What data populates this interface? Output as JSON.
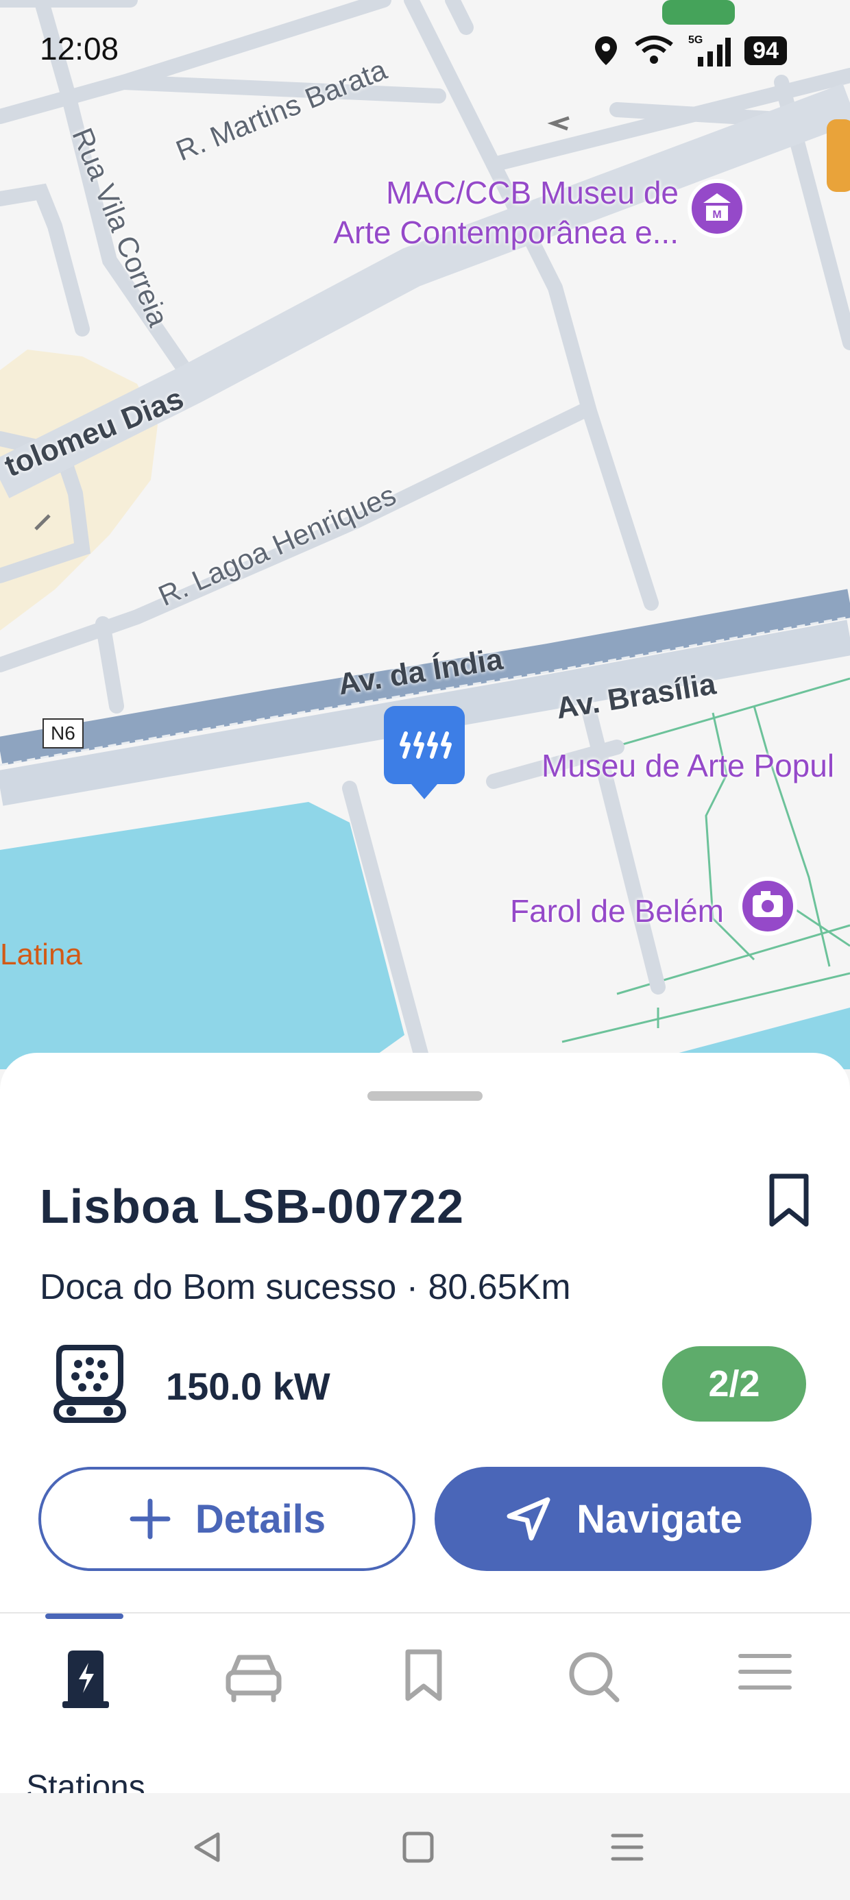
{
  "status_bar": {
    "time": "12:08",
    "battery": "94",
    "network": "5G"
  },
  "map": {
    "streets": {
      "martins_barata": "R. Martins Barata",
      "vila_correia": "Rua Vila Correia",
      "bartolomeu_dias": "tolomeu Dias",
      "lagoa_henriques": "R. Lagoa Henriques",
      "av_india": "Av. da Índia",
      "av_brasilia": "Av. Brasília"
    },
    "road_badge": "N6",
    "pois": {
      "mac_ccb_line1": "MAC/CCB Museu de",
      "mac_ccb_line2": "Arte Contemporânea e...",
      "museu_arte_popular": "Museu de Arte Popul",
      "farol_belem": "Farol de Belém",
      "latina": "Latina"
    },
    "icons": {
      "station_marker": "charging-station-marker-icon",
      "museum": "museum-icon",
      "camera": "camera-icon"
    }
  },
  "station": {
    "name": "Lisboa LSB-00722",
    "location": "Doca do Bom sucesso · 80.65Km",
    "power": "150.0 kW",
    "availability": "2/2",
    "buttons": {
      "details": "Details",
      "navigate": "Navigate"
    }
  },
  "tabs": [
    {
      "label": "Stations",
      "icon": "charging-station-icon",
      "active": true
    },
    {
      "label": "",
      "icon": "car-icon",
      "active": false
    },
    {
      "label": "",
      "icon": "bookmark-icon",
      "active": false
    },
    {
      "label": "",
      "icon": "search-icon",
      "active": false
    },
    {
      "label": "",
      "icon": "menu-icon",
      "active": false
    }
  ],
  "colors": {
    "primary": "#4a66b8",
    "available": "#5eac6b",
    "text_dark": "#1c2941",
    "poi": "#9549c9",
    "water": "#8fd6e8",
    "major_road": "#8ea4c0"
  }
}
